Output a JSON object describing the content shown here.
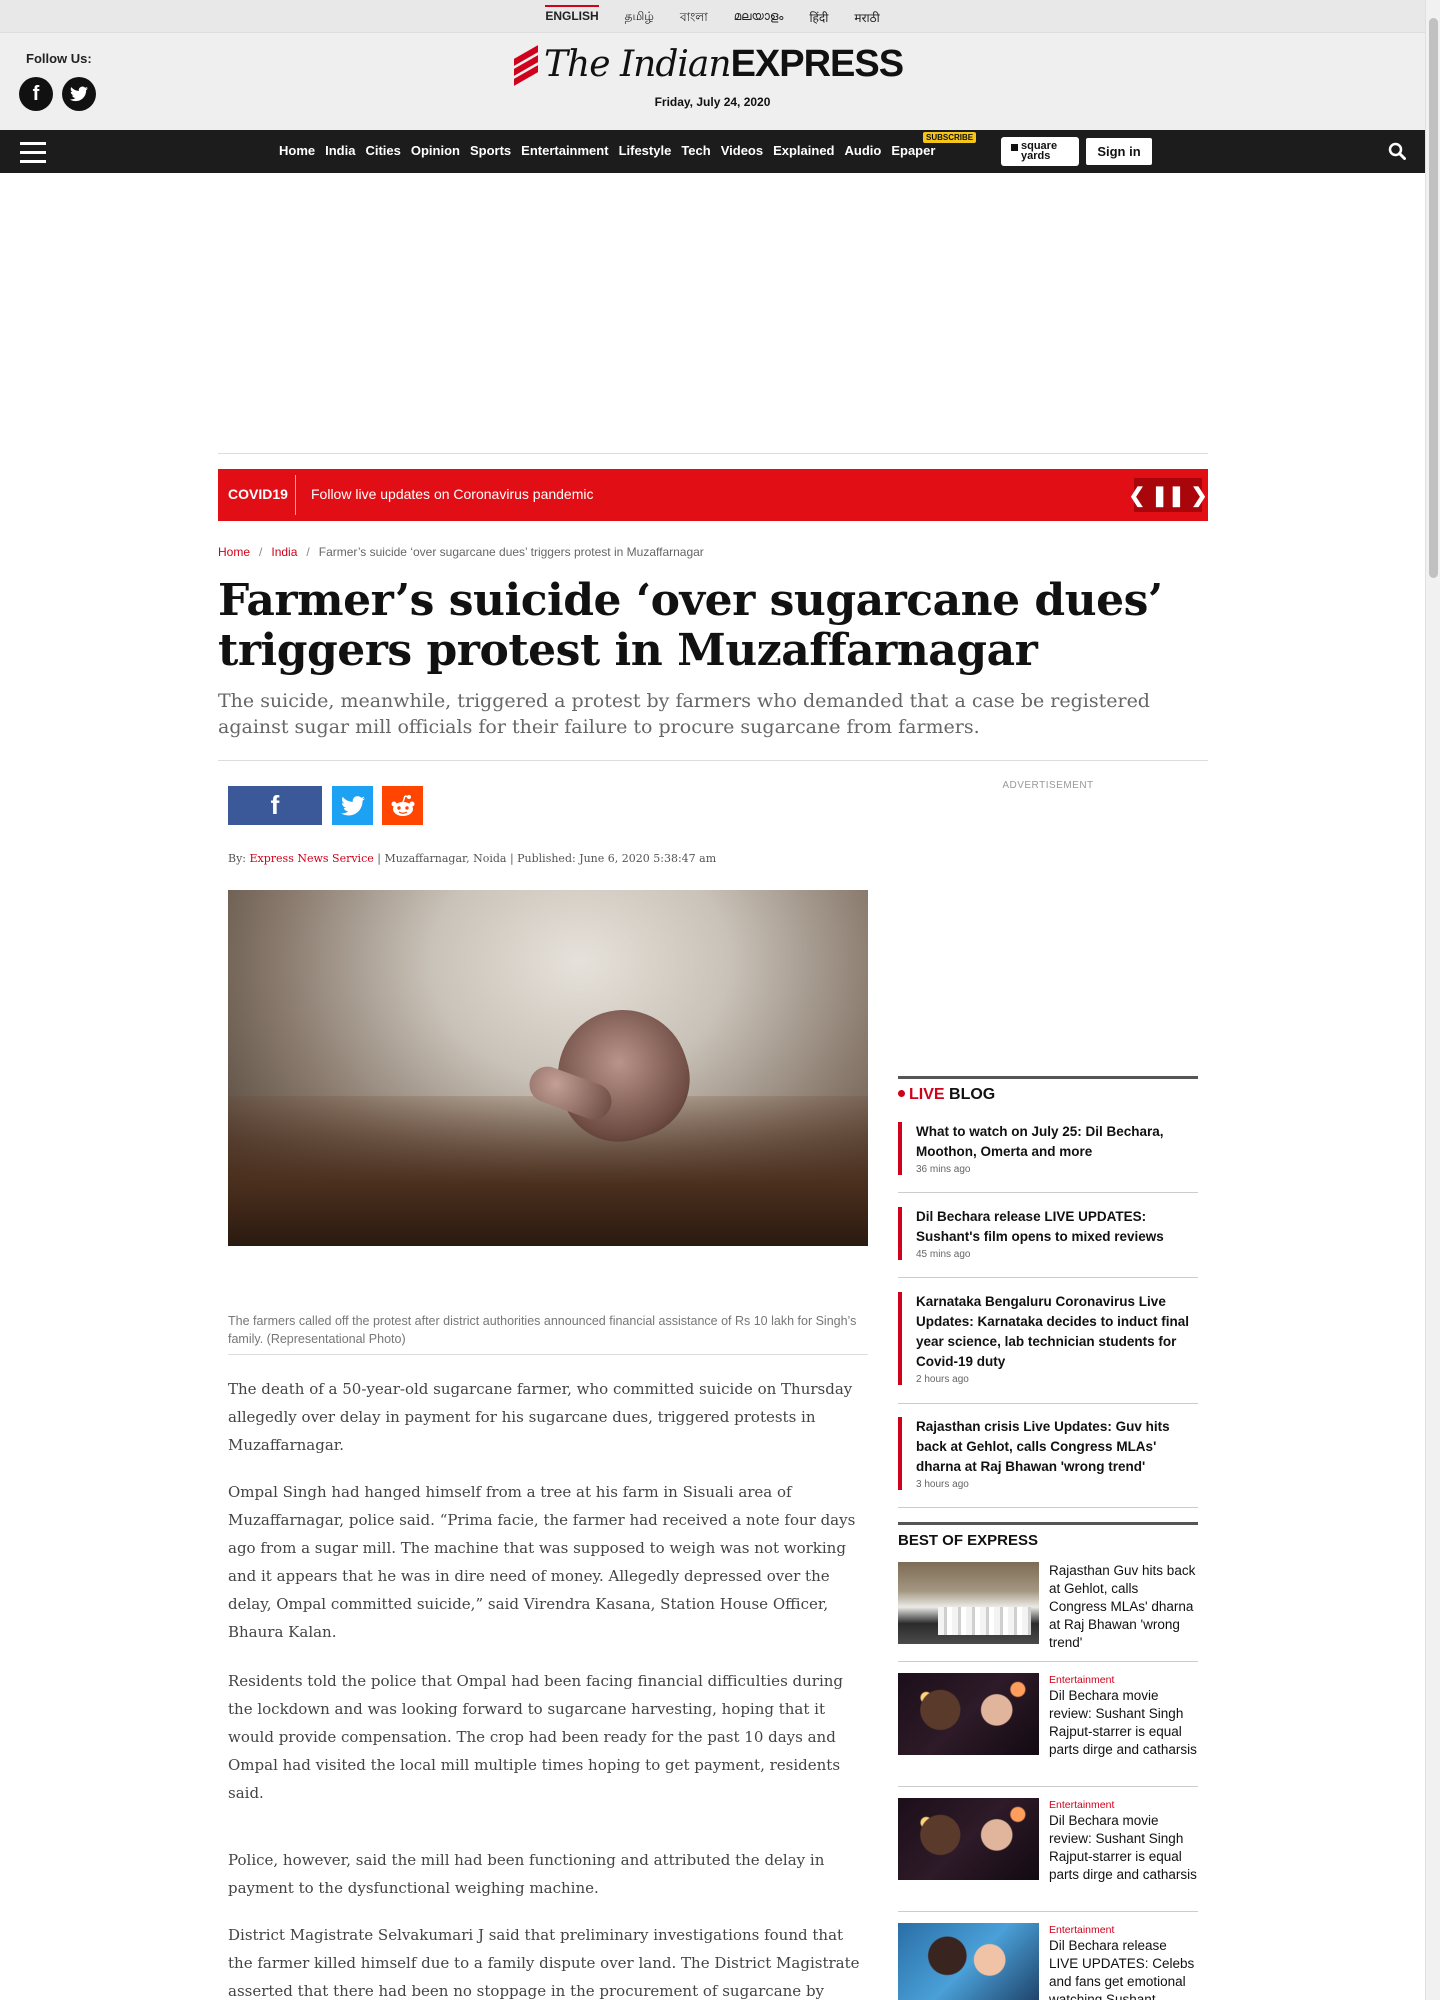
{
  "languages": [
    "ENGLISH",
    "தமிழ்",
    "বাংলা",
    "മലയാളം",
    "हिंदी",
    "मराठी"
  ],
  "header": {
    "follow_label": "Follow Us:",
    "logo_the": "The Indian",
    "logo_express": "EXPRESS",
    "date": "Friday, July 24, 2020"
  },
  "nav": {
    "links": [
      "Home",
      "India",
      "Cities",
      "Opinion",
      "Sports",
      "Entertainment",
      "Lifestyle",
      "Tech",
      "Videos",
      "Explained",
      "Audio",
      "Epaper"
    ],
    "subscribe_badge": "SUBSCRIBE",
    "square_yards": "square yards",
    "signin": "Sign in"
  },
  "covid": {
    "tag": "COVID19",
    "text": "Follow live updates on Coronavirus pandemic"
  },
  "breadcrumb": {
    "home": "Home",
    "section": "India",
    "current": "Farmer’s suicide ‘over sugarcane dues’ triggers protest in Muzaffarnagar"
  },
  "article": {
    "title": "Farmer’s suicide ‘over sugarcane dues’ triggers protest in Muzaffarnagar",
    "synopsis": "The suicide, meanwhile, triggered a protest by farmers who demanded that a case be registered against sugar mill officials for their failure to procure sugarcane from farmers.",
    "byline_prefix": "By:",
    "author": "Express News Service",
    "location": "Muzaffarnagar, Noida",
    "published": "Published: June 6, 2020 5:38:47 am",
    "caption": "The farmers called off the protest after district authorities announced financial assistance of Rs 10 lakh for Singh’s family. (Representational Photo)",
    "paragraphs": [
      "The death of a 50-year-old sugarcane farmer, who committed suicide on Thursday allegedly over delay in payment for his sugarcane dues, triggered protests in Muzaffarnagar.",
      "Ompal Singh had hanged himself from a tree at his farm in Sisuali area of Muzaffarnagar, police said. “Prima facie, the farmer had received a note four days ago from a sugar mill. The machine that was supposed to weigh was not working and it appears that he was in dire need of money. Allegedly depressed over the delay, Ompal committed suicide,” said Virendra Kasana, Station House Officer, Bhaura Kalan.",
      "Residents told the police that Ompal had been facing financial difficulties during the lockdown and was looking forward to sugarcane harvesting, hoping that it would provide compensation. The crop had been ready for the past 10 days and Ompal had visited the local mill multiple times hoping to get payment, residents said.",
      "Police, however, said the mill had been functioning and attributed the delay in payment to the dysfunctional weighing machine.",
      "District Magistrate Selvakumari J said that preliminary investigations found that the farmer killed himself due to a family dispute over land. The District Magistrate asserted that there had been no stoppage in the procurement of sugarcane by"
    ]
  },
  "sidebar": {
    "ad_label": "ADVERTISEMENT",
    "live_label": "LIVE",
    "blog_label": "BLOG",
    "live_items": [
      {
        "title": "What to watch on July 25: Dil Bechara, Moothon, Omerta and more",
        "ago": "36 mins ago"
      },
      {
        "title": "Dil Bechara release LIVE UPDATES: Sushant's film opens to mixed reviews",
        "ago": "45 mins ago"
      },
      {
        "title": "Karnataka Bengaluru Coronavirus Live Updates: Karnataka decides to induct final year science, lab technician students for Covid-19 duty",
        "ago": "2 hours ago"
      },
      {
        "title": "Rajasthan crisis Live Updates: Guv hits back at Gehlot, calls Congress MLAs' dharna at Raj Bhawan 'wrong trend'",
        "ago": "3 hours ago"
      }
    ],
    "best_label": "BEST OF EXPRESS",
    "best_items": [
      {
        "category": "",
        "title": "Rajasthan Guv hits back at Gehlot, calls Congress MLAs' dharna at Raj Bhawan 'wrong trend'"
      },
      {
        "category": "Entertainment",
        "title": "Dil Bechara movie review: Sushant Singh Rajput-starrer is equal parts dirge and catharsis"
      },
      {
        "category": "Entertainment",
        "title": "Dil Bechara movie review: Sushant Singh Rajput-starrer is equal parts dirge and catharsis"
      },
      {
        "category": "Entertainment",
        "title": "Dil Bechara release LIVE UPDATES: Celebs and fans get emotional watching Sushant"
      }
    ]
  }
}
